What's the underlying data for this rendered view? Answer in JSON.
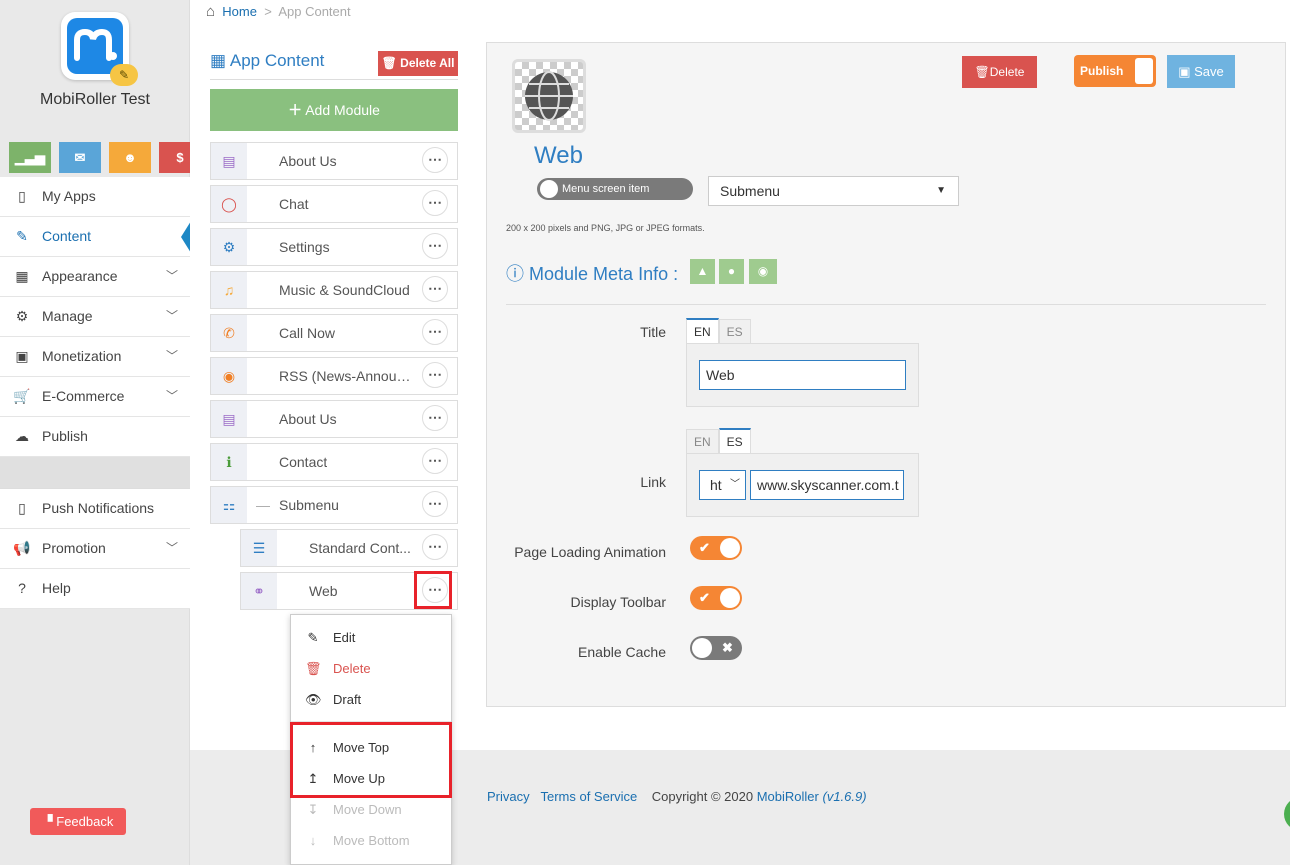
{
  "sidebar": {
    "app_name": "MobiRoller Test",
    "quick_buttons": [
      {
        "icon": "signal-icon",
        "glyph": "▁▃▅",
        "color": "#7db36a"
      },
      {
        "icon": "envelope-icon",
        "glyph": "✉",
        "color": "#5aa5d8"
      },
      {
        "icon": "users-icon",
        "glyph": "☻",
        "color": "#f5a93a"
      },
      {
        "icon": "dollar-icon",
        "glyph": "$",
        "color": "#d9534f"
      }
    ],
    "items": [
      {
        "label": "My Apps",
        "glyph": "▯"
      },
      {
        "label": "Content",
        "glyph": "✎"
      },
      {
        "label": "Appearance",
        "glyph": "▦"
      },
      {
        "label": "Manage",
        "glyph": "⚙"
      },
      {
        "label": "Monetization",
        "glyph": "▣"
      },
      {
        "label": "E-Commerce",
        "glyph": "🛒"
      },
      {
        "label": "Publish",
        "glyph": "☁"
      }
    ],
    "items2": [
      {
        "label": "Push Notifications",
        "glyph": "▯"
      },
      {
        "label": "Promotion",
        "glyph": "📢"
      },
      {
        "label": "Help",
        "glyph": "?"
      }
    ],
    "feedback": "Feedback"
  },
  "breadcrumb": {
    "home": "Home",
    "sep": ">",
    "current": "App Content"
  },
  "content": {
    "title": "App Content",
    "delete_all": "Delete All",
    "add_module": "Add Module",
    "modules": [
      {
        "label": "About Us",
        "glyph": "▤",
        "color": "#9b6bc8"
      },
      {
        "label": "Chat",
        "glyph": "◯",
        "color": "#d9534f"
      },
      {
        "label": "Settings",
        "glyph": "⚙",
        "color": "#2f7ec2"
      },
      {
        "label": "Music & SoundCloud",
        "glyph": "♫",
        "color": "#f5a93a"
      },
      {
        "label": "Call Now",
        "glyph": "✆",
        "color": "#f07f24"
      },
      {
        "label": "RSS (News-Announc...",
        "glyph": "◉",
        "color": "#f07f24"
      },
      {
        "label": "About Us",
        "glyph": "▤",
        "color": "#9b6bc8"
      },
      {
        "label": "Contact",
        "glyph": "ℹ",
        "color": "#4b9b3a"
      },
      {
        "label": "Submenu",
        "glyph": "⚏",
        "color": "#2f7ec2"
      }
    ],
    "submodules": [
      {
        "label": "Standard Cont...",
        "glyph": "☰",
        "color": "#2f7ec2"
      },
      {
        "label": "Web",
        "glyph": "⚭",
        "color": "#9b6bc8"
      }
    ],
    "submenu_prefix": "—"
  },
  "dropdown": {
    "items": [
      {
        "label": "Edit",
        "glyph": "✎",
        "state": "normal"
      },
      {
        "label": "Delete",
        "glyph": "🗑",
        "state": "danger"
      },
      {
        "label": "Draft",
        "glyph": "👁",
        "state": "normal"
      },
      {
        "label": "Move Top",
        "glyph": "↑",
        "state": "normal"
      },
      {
        "label": "Move Up",
        "glyph": "↥",
        "state": "normal"
      },
      {
        "label": "Move Down",
        "glyph": "↧",
        "state": "disabled"
      },
      {
        "label": "Move Bottom",
        "glyph": "↓",
        "state": "disabled"
      }
    ]
  },
  "editor": {
    "delete": "Delete",
    "publish": "Publish",
    "save": "Save",
    "module_title": "Web",
    "menu_screen_item": "Menu screen item",
    "submenu_select": "Submenu",
    "image_hint": "200 x 200 pixels and PNG, JPG or JPEG formats.",
    "meta_info": "Module Meta Info :",
    "title_label": "Title",
    "title_tabs": [
      "EN",
      "ES"
    ],
    "title_value": "Web",
    "link_label": "Link",
    "link_tabs": [
      "EN",
      "ES"
    ],
    "link_protocol": "ht",
    "link_value": "www.skyscanner.com.t",
    "page_loading": "Page Loading Animation",
    "display_toolbar": "Display Toolbar",
    "enable_cache": "Enable Cache"
  },
  "footer": {
    "privacy": "Privacy",
    "terms": "Terms of Service",
    "copyright": "Copyright © 2020",
    "brand": "MobiRoller",
    "version": "(v1.6.9)"
  },
  "colors": {
    "accent": "#2f7ec2",
    "orange": "#f58634",
    "red": "#d9534f",
    "green": "#8ac07f"
  }
}
